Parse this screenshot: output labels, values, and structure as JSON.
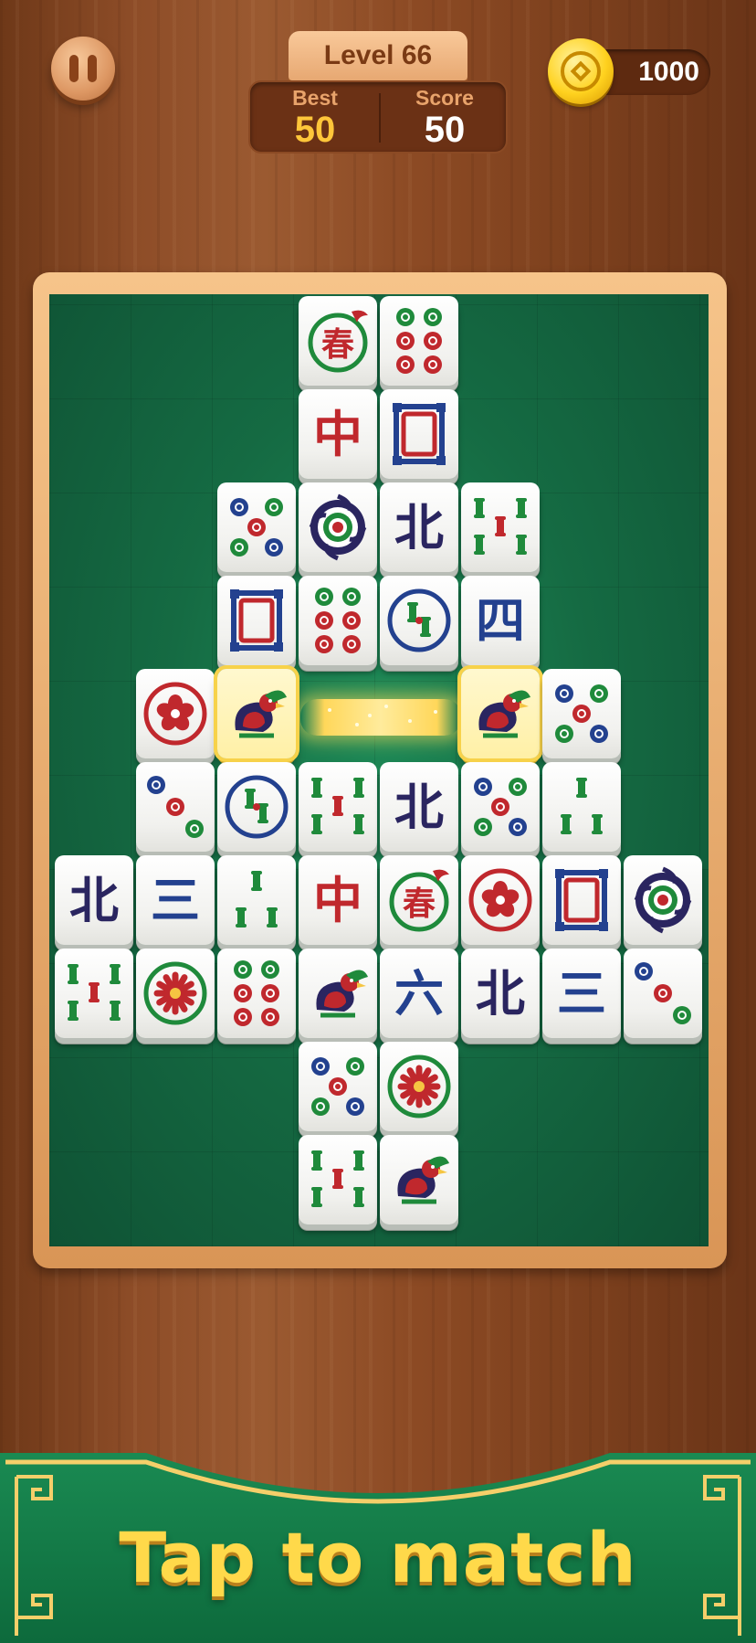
{
  "hud": {
    "level_label": "Level 66",
    "best_label": "Best",
    "best_value": "50",
    "score_label": "Score",
    "score_value": "50",
    "coins": "1000",
    "pause_icon": "pause-icon",
    "coin_icon": "coin-icon"
  },
  "colors": {
    "board_green": "#156b43",
    "wood": "#8e4d28",
    "gold": "#ffd94a",
    "highlight": "#f7d24a"
  },
  "tiles": [
    {
      "id": "r0c3",
      "kind": "spring-flower"
    },
    {
      "id": "r0c4",
      "kind": "dots-6"
    },
    {
      "id": "r1c3",
      "kind": "red-dragon",
      "text": "中"
    },
    {
      "id": "r1c4",
      "kind": "white-dragon"
    },
    {
      "id": "r2c2",
      "kind": "dots-5"
    },
    {
      "id": "r2c3",
      "kind": "dots-1"
    },
    {
      "id": "r2c4",
      "kind": "north-wind",
      "text": "北"
    },
    {
      "id": "r2c5",
      "kind": "bamboo-5"
    },
    {
      "id": "r3c2",
      "kind": "white-dragon"
    },
    {
      "id": "r3c3",
      "kind": "dots-6"
    },
    {
      "id": "r3c4",
      "kind": "bamboo-plum"
    },
    {
      "id": "r3c5",
      "kind": "four-character",
      "text": "四"
    },
    {
      "id": "r4c1",
      "kind": "plum-flower"
    },
    {
      "id": "r4c2",
      "kind": "bird",
      "selected": true
    },
    {
      "id": "r4c5",
      "kind": "bird",
      "selected": true
    },
    {
      "id": "r4c6",
      "kind": "dots-5"
    },
    {
      "id": "r5c1",
      "kind": "dots-3"
    },
    {
      "id": "r5c2",
      "kind": "bamboo-plum"
    },
    {
      "id": "r5c3",
      "kind": "bamboo-5"
    },
    {
      "id": "r5c4",
      "kind": "north-wind",
      "text": "北"
    },
    {
      "id": "r5c5",
      "kind": "dots-5"
    },
    {
      "id": "r5c6",
      "kind": "bamboo-3"
    },
    {
      "id": "r6c0",
      "kind": "north-wind",
      "text": "北"
    },
    {
      "id": "r6c1",
      "kind": "three-character",
      "text": "三"
    },
    {
      "id": "r6c2",
      "kind": "bamboo-3"
    },
    {
      "id": "r6c3",
      "kind": "red-dragon",
      "text": "中"
    },
    {
      "id": "r6c4",
      "kind": "spring-flower"
    },
    {
      "id": "r6c5",
      "kind": "plum-flower"
    },
    {
      "id": "r6c6",
      "kind": "white-dragon"
    },
    {
      "id": "r6c7",
      "kind": "dots-1"
    },
    {
      "id": "r7c0",
      "kind": "bamboo-5"
    },
    {
      "id": "r7c1",
      "kind": "chrysanthemum"
    },
    {
      "id": "r7c2",
      "kind": "dots-6"
    },
    {
      "id": "r7c3",
      "kind": "bird"
    },
    {
      "id": "r7c4",
      "kind": "six-character",
      "text": "六"
    },
    {
      "id": "r7c5",
      "kind": "north-wind",
      "text": "北"
    },
    {
      "id": "r7c6",
      "kind": "three-character",
      "text": "三"
    },
    {
      "id": "r7c7",
      "kind": "dots-3"
    },
    {
      "id": "r8c3",
      "kind": "dots-5"
    },
    {
      "id": "r8c4",
      "kind": "chrysanthemum"
    },
    {
      "id": "r9c3",
      "kind": "bamboo-5"
    },
    {
      "id": "r9c4",
      "kind": "bird"
    }
  ],
  "spring_text": "春",
  "banner": {
    "text": "Tap to match"
  }
}
